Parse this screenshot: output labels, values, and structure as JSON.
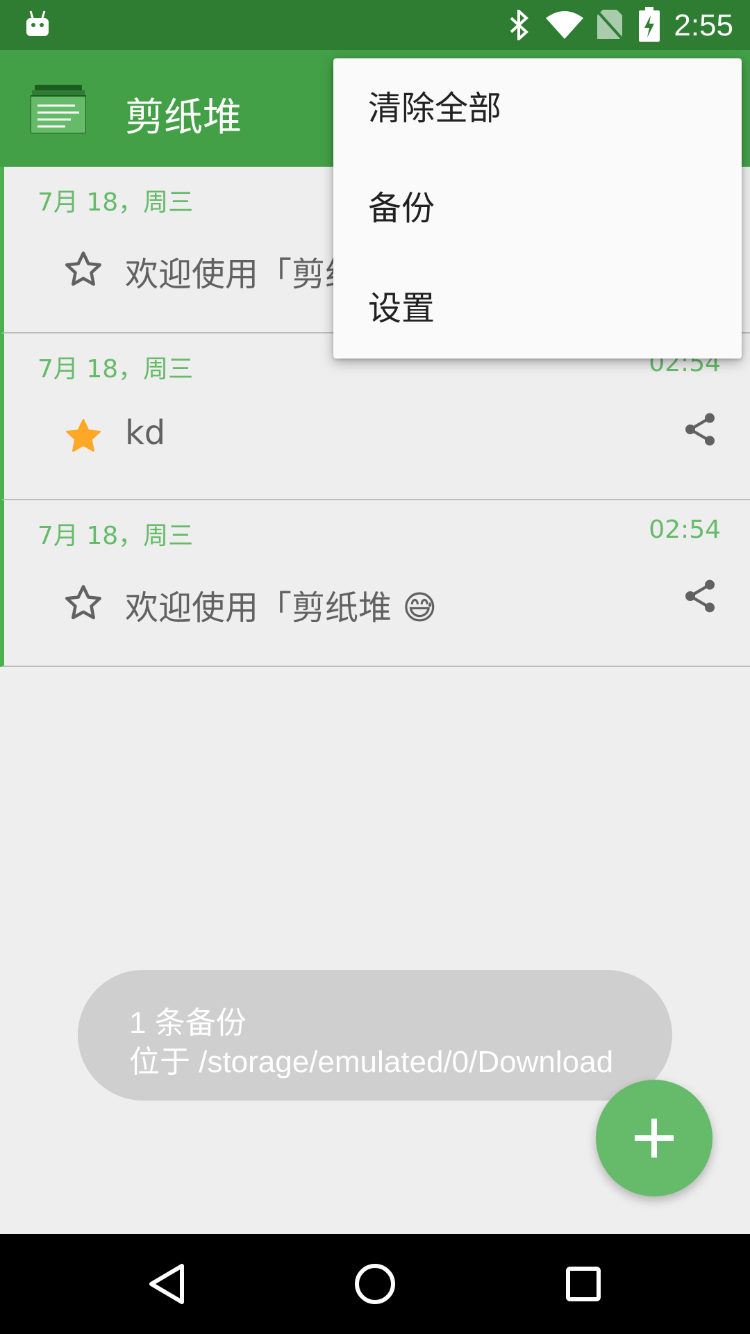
{
  "status_bar": {
    "time": "2:55",
    "icons": [
      "android-icon",
      "bluetooth-icon",
      "wifi-icon",
      "no-sim-icon",
      "battery-charging-icon"
    ]
  },
  "app_bar": {
    "title": "剪纸堆",
    "logo_icon": "clipboard-stack-icon"
  },
  "clips": [
    {
      "date": "7月 18，周三",
      "time": "",
      "text": "欢迎使用「剪纸堆",
      "starred": false
    },
    {
      "date": "7月 18，周三",
      "time": "02:54",
      "text": "kd",
      "starred": true
    },
    {
      "date": "7月 18，周三",
      "time": "02:54",
      "text": "欢迎使用「剪纸堆 😅",
      "starred": false
    }
  ],
  "overflow_menu": {
    "items": [
      {
        "label": "清除全部"
      },
      {
        "label": "备份"
      },
      {
        "label": "设置"
      }
    ]
  },
  "toast": {
    "line1": "1 条备份",
    "line2": "位于 /storage/emulated/0/Download"
  },
  "fab": {
    "icon": "plus-icon"
  },
  "nav_bar": {
    "icons": [
      "back-icon",
      "home-icon",
      "recents-icon"
    ]
  },
  "colors": {
    "status_bar": "#2e7d32",
    "app_bar": "#43a047",
    "accent_green": "#66bb6a",
    "star_on": "#ffa726"
  }
}
